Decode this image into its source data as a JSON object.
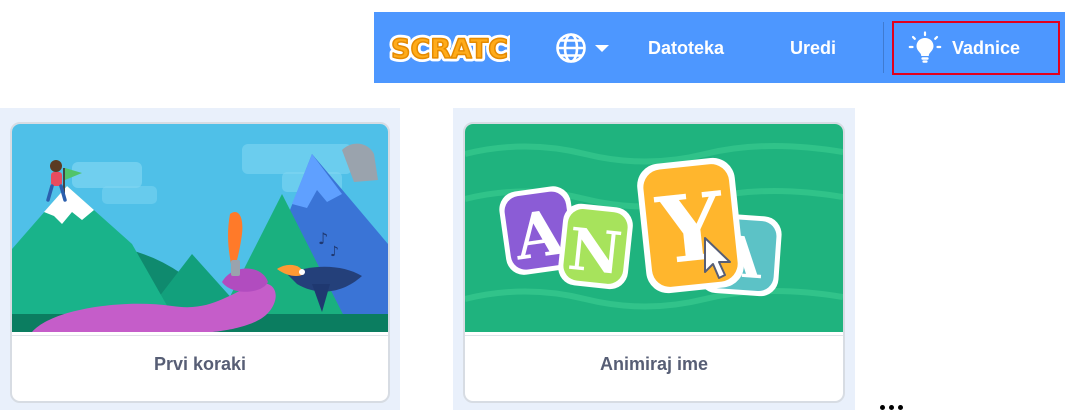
{
  "menubar": {
    "logo_text": "SCRATCH",
    "language_icon": "globe-icon",
    "file_label": "Datoteka",
    "edit_label": "Uredi",
    "tutorials_label": "Vadnice",
    "tutorials_icon": "lightbulb-icon",
    "bar_color": "#4d97ff",
    "highlight_color": "#e3001b"
  },
  "cards": [
    {
      "title": "Prvi koraki"
    },
    {
      "title": "Animiraj ime",
      "thumbnail_letters": "ANYA"
    }
  ]
}
